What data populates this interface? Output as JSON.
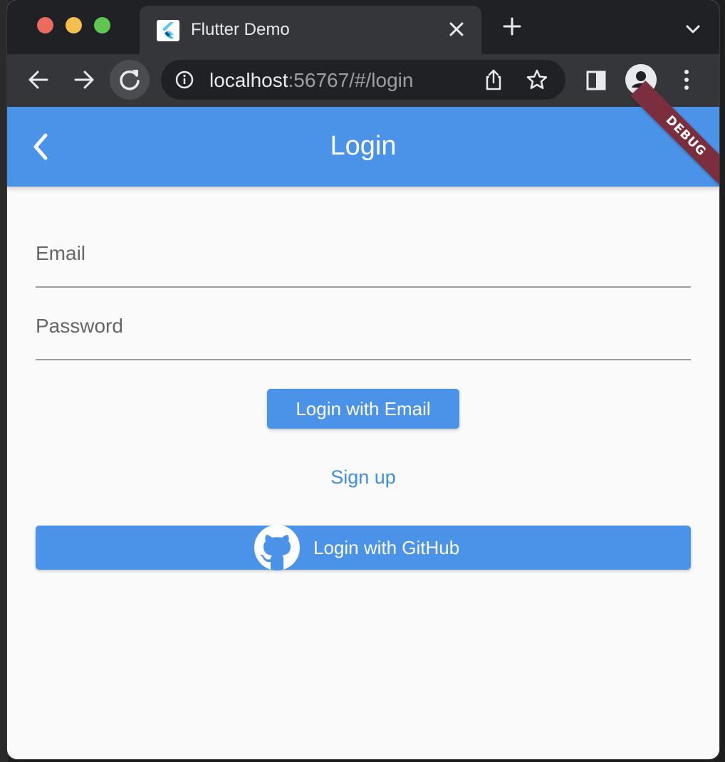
{
  "browser": {
    "tab": {
      "title": "Flutter Demo",
      "favicon": "flutter-icon"
    },
    "address": {
      "host": "localhost",
      "rest": ":56767/#/login"
    },
    "colors": {
      "tabstrip": "#202124",
      "toolbar": "#35363a"
    }
  },
  "app": {
    "appbar": {
      "title": "Login",
      "debug_banner": "DEBUG",
      "color": "#4a93e8"
    },
    "form": {
      "email_placeholder": "Email",
      "password_placeholder": "Password",
      "login_email_label": "Login with Email",
      "signup_label": "Sign up",
      "login_github_label": "Login with GitHub"
    },
    "colors": {
      "primary": "#4a93e8",
      "link": "#3d8fe5",
      "background": "#fafafa"
    }
  }
}
